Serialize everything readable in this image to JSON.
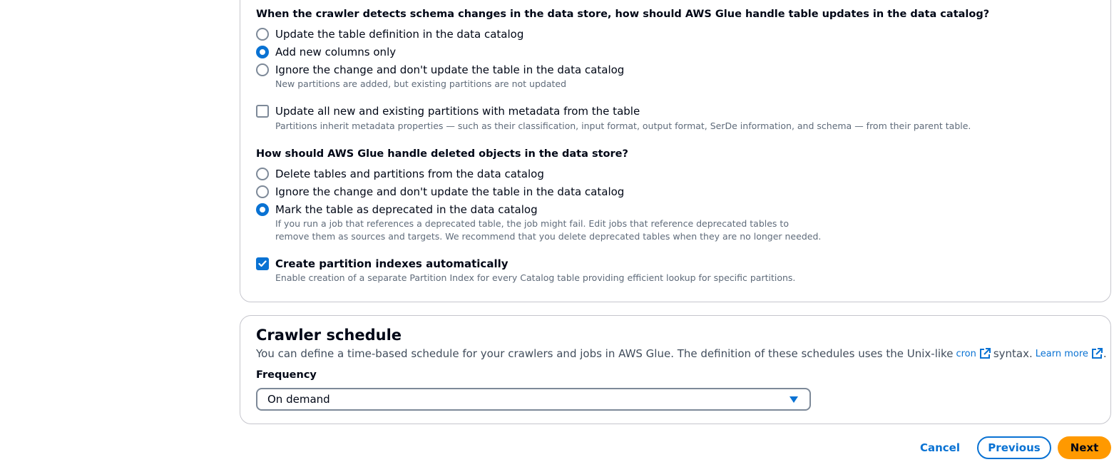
{
  "schema_changes": {
    "question": "When the crawler detects schema changes in the data store, how should AWS Glue handle table updates in the data catalog?",
    "options": [
      {
        "label": "Update the table definition in the data catalog",
        "selected": false
      },
      {
        "label": "Add new columns only",
        "selected": true
      },
      {
        "label": "Ignore the change and don't update the table in the data catalog",
        "selected": false,
        "description": "New partitions are added, but existing partitions are not updated"
      }
    ]
  },
  "partitions_checkbox": {
    "label": "Update all new and existing partitions with metadata from the table",
    "checked": false,
    "description": "Partitions inherit metadata properties — such as their classification, input format, output format, SerDe information, and schema — from their parent table."
  },
  "deleted_objects": {
    "question": "How should AWS Glue handle deleted objects in the data store?",
    "options": [
      {
        "label": "Delete tables and partitions from the data catalog",
        "selected": false
      },
      {
        "label": "Ignore the change and don't update the table in the data catalog",
        "selected": false
      },
      {
        "label": "Mark the table as deprecated in the data catalog",
        "selected": true,
        "description_line1": "If you run a job that references a deprecated table, the job might fail. Edit jobs that reference deprecated tables to",
        "description_line2": "remove them as sources and targets. We recommend that you delete deprecated tables when they are no longer needed."
      }
    ]
  },
  "partition_indexes": {
    "label": "Create partition indexes automatically",
    "checked": true,
    "description": "Enable creation of a separate Partition Index for every Catalog table providing efficient lookup for specific partitions."
  },
  "schedule": {
    "title": "Crawler schedule",
    "desc_part1": "You can define a time-based schedule for your crawlers and jobs in AWS Glue. The definition of these schedules uses the Unix-like",
    "cron_link": "cron",
    "desc_part2": "syntax.",
    "learn_more": "Learn more",
    "desc_end": ".",
    "frequency_label": "Frequency",
    "frequency_value": "On demand"
  },
  "footer": {
    "cancel": "Cancel",
    "previous": "Previous",
    "next": "Next"
  },
  "colors": {
    "accent": "#0972d3",
    "primary_button": "#ff9900"
  }
}
